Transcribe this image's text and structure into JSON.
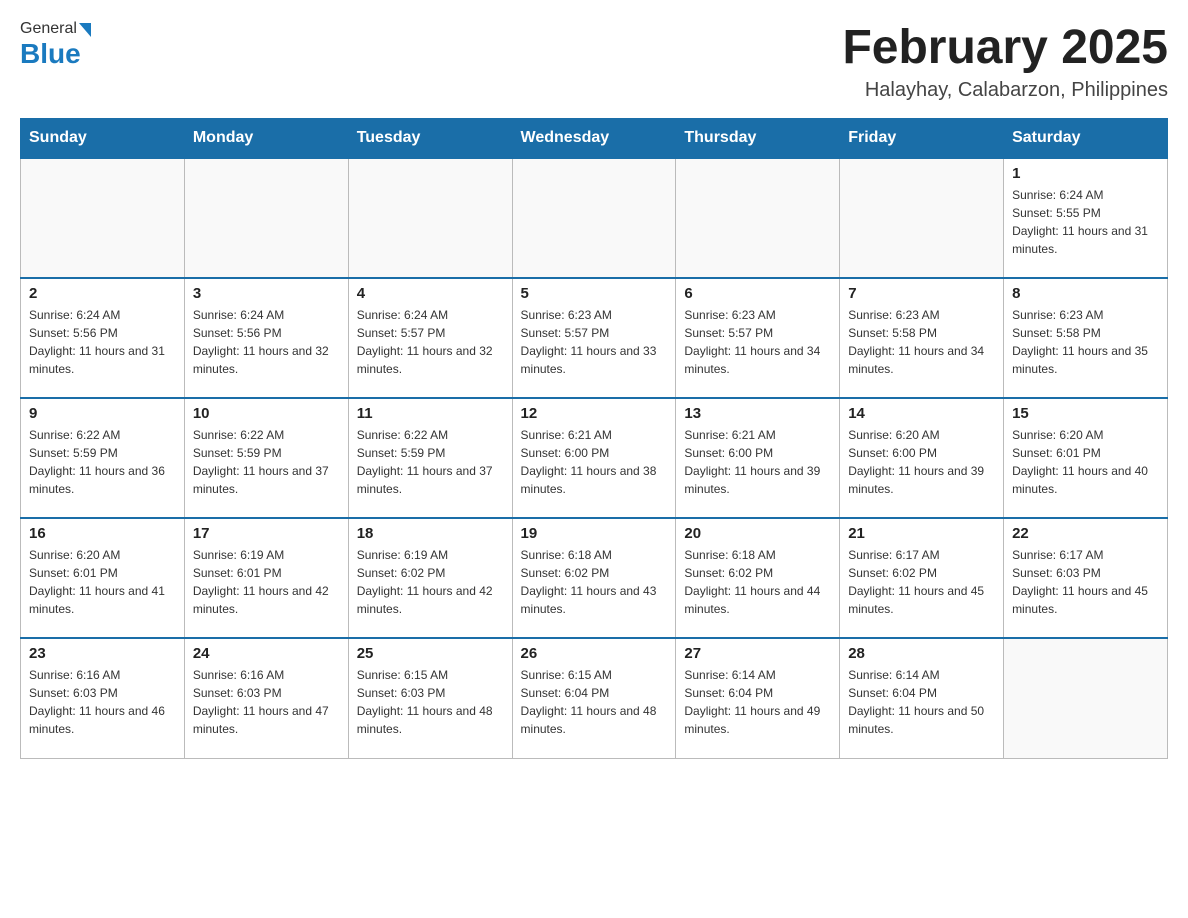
{
  "header": {
    "logo": {
      "general": "General",
      "blue": "Blue"
    },
    "title": "February 2025",
    "location": "Halayhay, Calabarzon, Philippines"
  },
  "weekdays": [
    "Sunday",
    "Monday",
    "Tuesday",
    "Wednesday",
    "Thursday",
    "Friday",
    "Saturday"
  ],
  "weeks": [
    [
      {
        "day": "",
        "info": ""
      },
      {
        "day": "",
        "info": ""
      },
      {
        "day": "",
        "info": ""
      },
      {
        "day": "",
        "info": ""
      },
      {
        "day": "",
        "info": ""
      },
      {
        "day": "",
        "info": ""
      },
      {
        "day": "1",
        "info": "Sunrise: 6:24 AM\nSunset: 5:55 PM\nDaylight: 11 hours and 31 minutes."
      }
    ],
    [
      {
        "day": "2",
        "info": "Sunrise: 6:24 AM\nSunset: 5:56 PM\nDaylight: 11 hours and 31 minutes."
      },
      {
        "day": "3",
        "info": "Sunrise: 6:24 AM\nSunset: 5:56 PM\nDaylight: 11 hours and 32 minutes."
      },
      {
        "day": "4",
        "info": "Sunrise: 6:24 AM\nSunset: 5:57 PM\nDaylight: 11 hours and 32 minutes."
      },
      {
        "day": "5",
        "info": "Sunrise: 6:23 AM\nSunset: 5:57 PM\nDaylight: 11 hours and 33 minutes."
      },
      {
        "day": "6",
        "info": "Sunrise: 6:23 AM\nSunset: 5:57 PM\nDaylight: 11 hours and 34 minutes."
      },
      {
        "day": "7",
        "info": "Sunrise: 6:23 AM\nSunset: 5:58 PM\nDaylight: 11 hours and 34 minutes."
      },
      {
        "day": "8",
        "info": "Sunrise: 6:23 AM\nSunset: 5:58 PM\nDaylight: 11 hours and 35 minutes."
      }
    ],
    [
      {
        "day": "9",
        "info": "Sunrise: 6:22 AM\nSunset: 5:59 PM\nDaylight: 11 hours and 36 minutes."
      },
      {
        "day": "10",
        "info": "Sunrise: 6:22 AM\nSunset: 5:59 PM\nDaylight: 11 hours and 37 minutes."
      },
      {
        "day": "11",
        "info": "Sunrise: 6:22 AM\nSunset: 5:59 PM\nDaylight: 11 hours and 37 minutes."
      },
      {
        "day": "12",
        "info": "Sunrise: 6:21 AM\nSunset: 6:00 PM\nDaylight: 11 hours and 38 minutes."
      },
      {
        "day": "13",
        "info": "Sunrise: 6:21 AM\nSunset: 6:00 PM\nDaylight: 11 hours and 39 minutes."
      },
      {
        "day": "14",
        "info": "Sunrise: 6:20 AM\nSunset: 6:00 PM\nDaylight: 11 hours and 39 minutes."
      },
      {
        "day": "15",
        "info": "Sunrise: 6:20 AM\nSunset: 6:01 PM\nDaylight: 11 hours and 40 minutes."
      }
    ],
    [
      {
        "day": "16",
        "info": "Sunrise: 6:20 AM\nSunset: 6:01 PM\nDaylight: 11 hours and 41 minutes."
      },
      {
        "day": "17",
        "info": "Sunrise: 6:19 AM\nSunset: 6:01 PM\nDaylight: 11 hours and 42 minutes."
      },
      {
        "day": "18",
        "info": "Sunrise: 6:19 AM\nSunset: 6:02 PM\nDaylight: 11 hours and 42 minutes."
      },
      {
        "day": "19",
        "info": "Sunrise: 6:18 AM\nSunset: 6:02 PM\nDaylight: 11 hours and 43 minutes."
      },
      {
        "day": "20",
        "info": "Sunrise: 6:18 AM\nSunset: 6:02 PM\nDaylight: 11 hours and 44 minutes."
      },
      {
        "day": "21",
        "info": "Sunrise: 6:17 AM\nSunset: 6:02 PM\nDaylight: 11 hours and 45 minutes."
      },
      {
        "day": "22",
        "info": "Sunrise: 6:17 AM\nSunset: 6:03 PM\nDaylight: 11 hours and 45 minutes."
      }
    ],
    [
      {
        "day": "23",
        "info": "Sunrise: 6:16 AM\nSunset: 6:03 PM\nDaylight: 11 hours and 46 minutes."
      },
      {
        "day": "24",
        "info": "Sunrise: 6:16 AM\nSunset: 6:03 PM\nDaylight: 11 hours and 47 minutes."
      },
      {
        "day": "25",
        "info": "Sunrise: 6:15 AM\nSunset: 6:03 PM\nDaylight: 11 hours and 48 minutes."
      },
      {
        "day": "26",
        "info": "Sunrise: 6:15 AM\nSunset: 6:04 PM\nDaylight: 11 hours and 48 minutes."
      },
      {
        "day": "27",
        "info": "Sunrise: 6:14 AM\nSunset: 6:04 PM\nDaylight: 11 hours and 49 minutes."
      },
      {
        "day": "28",
        "info": "Sunrise: 6:14 AM\nSunset: 6:04 PM\nDaylight: 11 hours and 50 minutes."
      },
      {
        "day": "",
        "info": ""
      }
    ]
  ]
}
